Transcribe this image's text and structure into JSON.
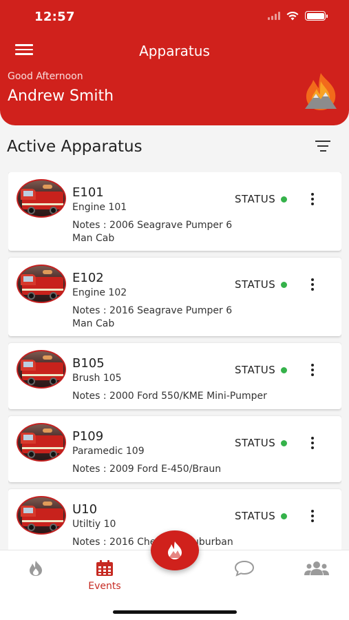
{
  "status_bar": {
    "time": "12:57"
  },
  "header": {
    "title": "Apparatus",
    "greeting": "Good Afternoon",
    "user_name": "Andrew Smith",
    "menu_icon": "hamburger-menu-icon",
    "logo_icon": "flame-mountain-logo"
  },
  "section": {
    "title": "Active Apparatus",
    "filter_icon": "filter-icon"
  },
  "apparatus": [
    {
      "code": "E101",
      "name": "Engine 101",
      "notes": "Notes : 2006 Seagrave Pumper 6 Man Cab",
      "status_label": "STATUS",
      "status_color": "#35b24a"
    },
    {
      "code": "E102",
      "name": "Engine 102",
      "notes": "Notes : 2016 Seagrave Pumper 6 Man Cab",
      "status_label": "STATUS",
      "status_color": "#35b24a"
    },
    {
      "code": "B105",
      "name": "Brush 105",
      "notes": "Notes : 2000 Ford 550/KME Mini-Pumper",
      "status_label": "STATUS",
      "status_color": "#35b24a"
    },
    {
      "code": "P109",
      "name": "Paramedic 109",
      "notes": "Notes : 2009 Ford E-450/Braun",
      "status_label": "STATUS",
      "status_color": "#35b24a"
    },
    {
      "code": "U10",
      "name": "Utiltiy 10",
      "notes": "Notes : 2016 Chevrolet Suburban",
      "status_label": "STATUS",
      "status_color": "#35b24a"
    }
  ],
  "tabs": [
    {
      "icon": "flame-icon",
      "label": ""
    },
    {
      "icon": "calendar-icon",
      "label": "Events",
      "active": true
    },
    {
      "icon": "chat-bubble-icon",
      "label": ""
    },
    {
      "icon": "users-icon",
      "label": ""
    }
  ],
  "fab": {
    "icon": "flame-mountain-icon"
  },
  "colors": {
    "brand": "#d0211c",
    "status_ok": "#35b24a",
    "active_tab": "#c62a22"
  }
}
